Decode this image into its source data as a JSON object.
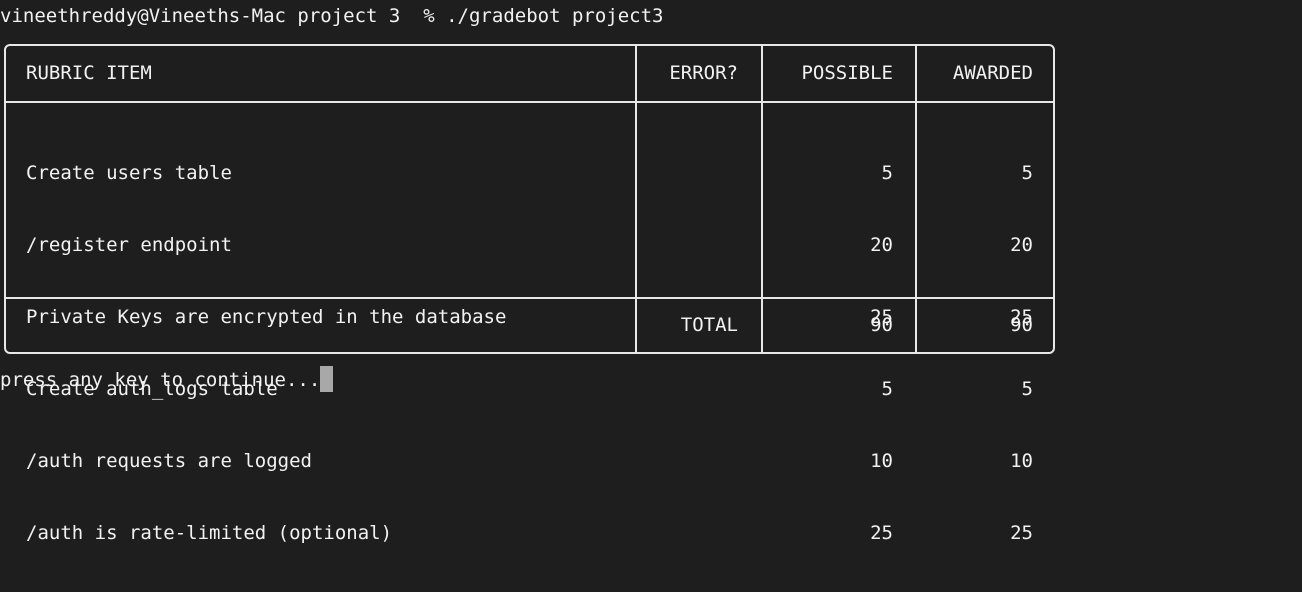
{
  "terminal": {
    "prompt": "vineethreddy@Vineeths-Mac project 3  % ./gradebot project3",
    "continue_text": "press any key to continue..."
  },
  "table": {
    "headers": {
      "item": "RUBRIC ITEM",
      "error": "ERROR?",
      "possible": "POSSIBLE",
      "awarded": "AWARDED"
    },
    "rows": [
      {
        "item": "Create users table",
        "error": "",
        "possible": "5",
        "awarded": "5"
      },
      {
        "item": "/register endpoint",
        "error": "",
        "possible": "20",
        "awarded": "20"
      },
      {
        "item": "Private Keys are encrypted in the database",
        "error": "",
        "possible": "25",
        "awarded": "25"
      },
      {
        "item": "Create auth_logs table",
        "error": "",
        "possible": "5",
        "awarded": "5"
      },
      {
        "item": "/auth requests are logged",
        "error": "",
        "possible": "10",
        "awarded": "10"
      },
      {
        "item": "/auth is rate-limited (optional)",
        "error": "",
        "possible": "25",
        "awarded": "25"
      }
    ],
    "total": {
      "label": "TOTAL",
      "possible": "90",
      "awarded": "90"
    }
  },
  "colors": {
    "background": "#1e1e1e",
    "text": "#f2f2f2",
    "cursor": "#a8a8a8"
  }
}
